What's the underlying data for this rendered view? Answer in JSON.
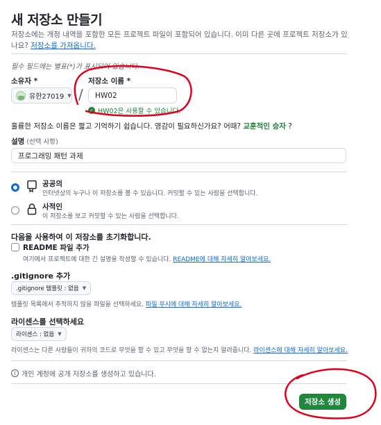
{
  "header": {
    "title": "새 저장소 만들기",
    "intro_text": "저장소에는 개정 내역을 포함한 모든 프로젝트 파일이 포함되어 있습니다. 이미 다른 곳에 프로젝트 저장소가 있나요? ",
    "import_link": "저장소를 가져옵니다."
  },
  "required_note": "필수 필드에는 별표(*)가 표시되어 있습니다.",
  "owner": {
    "label": "소유자",
    "required_mark": " *",
    "value": "유한27019"
  },
  "repo_name": {
    "label": "저장소 이름",
    "required_mark": " *",
    "value": "HW02",
    "availability": "HW02은 사용할 수 있습니다."
  },
  "suggestion": {
    "text": "훌륭한 저장소 이름은 짧고 기억하기 쉽습니다. 영감이 필요하신가요? 어때? ",
    "suggested_name": "교훈적인 승자",
    "suffix": " ?"
  },
  "description": {
    "label": "설명",
    "optional": " (선택 사항)",
    "value": "프로그래밍 패턴 과제"
  },
  "visibility": {
    "public": {
      "title": "공공의",
      "desc": "인터넷상의 누구나 이 저장소를 볼 수 있습니다. 커밋할 수 있는 사람을 선택합니다.",
      "selected": true
    },
    "private": {
      "title": "사적인",
      "desc": "이 저장소를 보고 커밋할 수 있는 사람을 선택합니다.",
      "selected": false
    }
  },
  "initialize": {
    "title": "다음을 사용하여 이 저장소를 초기화합니다.",
    "readme": {
      "label": "README 파일 추가",
      "desc": "여기에서 프로젝트에 대한 긴 설명을 작성할 수 있습니다. ",
      "link": "README에 대해 자세히 알아보세요."
    }
  },
  "gitignore": {
    "title": ".gitignore 추가",
    "dropdown": ".gitignore 템플릿 : 없음",
    "desc": "템플릿 목록에서 추적하지 않을 파일을 선택하세요. ",
    "link": "파일 무시에 대해 자세히 알아보세요."
  },
  "license": {
    "title": "라이센스를 선택하세요",
    "dropdown": "라이센스 : 없음",
    "desc": "라이센스는 다른 사람들이 귀하의 코드로 무엇을 할 수 있고 무엇을 할 수 없는지 알려줍니다. ",
    "link": "라이센스에 대해 자세히 알아보세요."
  },
  "footer": {
    "info": "개인 계정에 공개 저장소를 생성하고 있습니다.",
    "create_button": "저장소 생성"
  },
  "colors": {
    "primary_button": "#1f883d",
    "link": "#0969da",
    "success": "#1a7f37",
    "annotation": "#e0001a"
  }
}
